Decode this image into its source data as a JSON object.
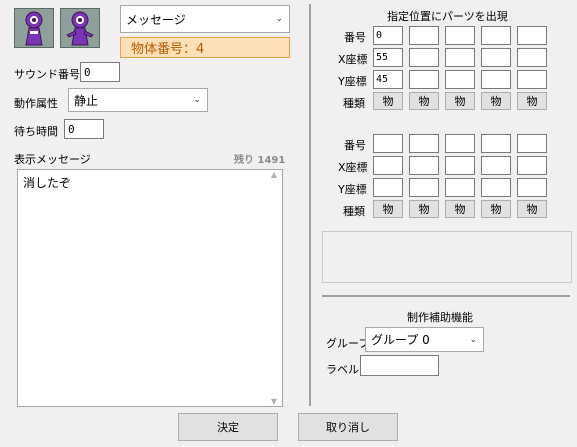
{
  "sprites": [
    "wizard-sprite-1",
    "wizard-sprite-2"
  ],
  "type_select": {
    "value": "メッセージ"
  },
  "object_number": {
    "text": "物体番号：4"
  },
  "sound": {
    "label": "サウンド番号",
    "value": "0"
  },
  "action": {
    "label": "動作属性",
    "value": "静止"
  },
  "wait": {
    "label": "待ち時間",
    "value": "0"
  },
  "message": {
    "label": "表示メッセージ",
    "remaining": "残り 1491",
    "text": "消したぞ"
  },
  "parts": {
    "title": "指定位置にパーツを出現",
    "row_labels": [
      "番号",
      "X座標",
      "Y座標",
      "種類"
    ],
    "kind_button": "物",
    "group1": {
      "number": [
        "0",
        "",
        "",
        "",
        ""
      ],
      "x": [
        "55",
        "",
        "",
        "",
        ""
      ],
      "y": [
        "45",
        "",
        "",
        "",
        ""
      ]
    },
    "group2": {
      "number": [
        "",
        "",
        "",
        "",
        ""
      ],
      "x": [
        "",
        "",
        "",
        "",
        ""
      ],
      "y": [
        "",
        "",
        "",
        "",
        ""
      ]
    }
  },
  "assist": {
    "title": "制作補助機能",
    "group_label": "グループ",
    "group_value": "グループ 0",
    "label_label": "ラベル",
    "label_value": ""
  },
  "buttons": {
    "ok": "決定",
    "cancel": "取り消し"
  },
  "colors": {
    "object_number_bg": "#fde0b6",
    "object_number_border": "#e8a04a",
    "object_number_text": "#b85c00",
    "sprite_purple": "#8a3fbf"
  }
}
